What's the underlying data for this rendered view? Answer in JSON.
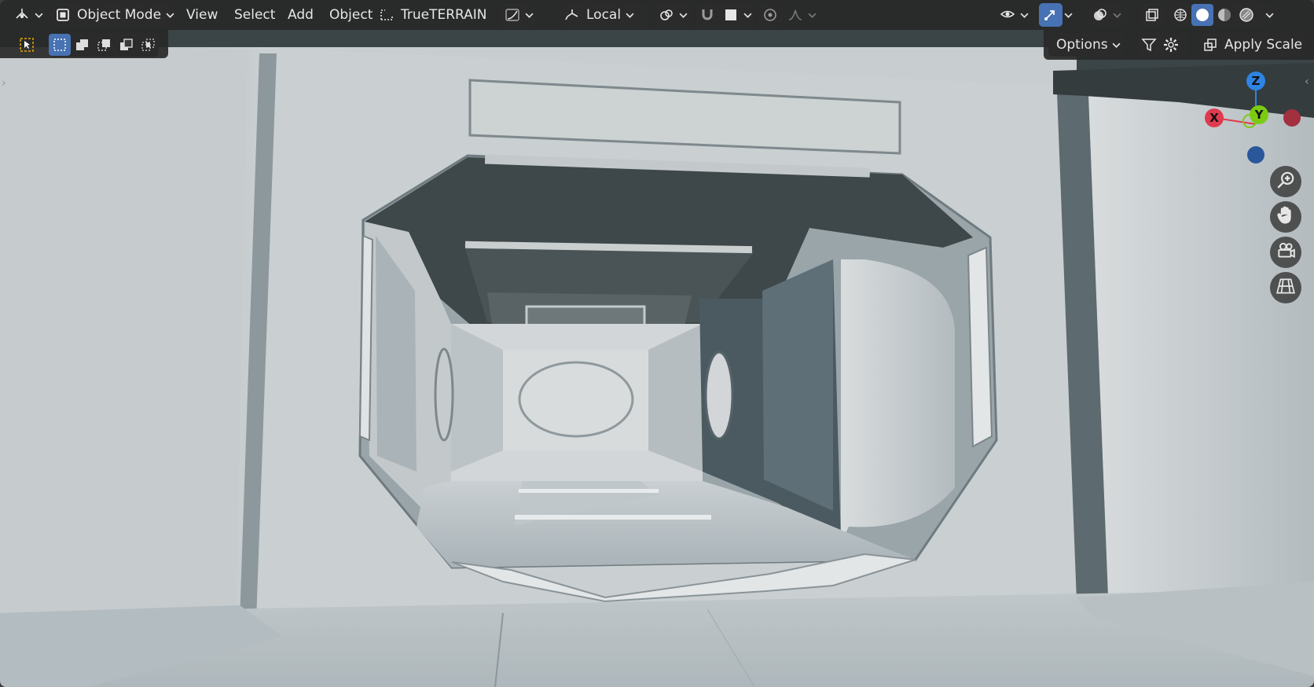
{
  "header": {
    "editor_type_icon": "object-3d-viewport-icon",
    "mode_label": "Object Mode",
    "menus": [
      "View",
      "Select",
      "Add",
      "Object"
    ],
    "addon_label": "TrueTERRAIN",
    "transform_orientation": "Local"
  },
  "toolbar": {
    "select_tools": [
      "cursor-select-icon",
      "box-select-new-icon",
      "box-select-extend-icon",
      "box-select-subtract-icon",
      "box-select-invert-icon",
      "box-select-intersect-icon"
    ]
  },
  "options": {
    "options_label": "Options",
    "apply_scale_label": "Apply Scale"
  },
  "gizmo": {
    "axis_z": "Z",
    "axis_y": "Y",
    "axis_x": "X",
    "colors": {
      "x": "#e03a4e",
      "y": "#7ccb13",
      "z": "#2f83e3",
      "neg_z": "#2a5799",
      "neg_x": "#a3303f"
    }
  },
  "navigation": [
    "zoom-icon",
    "pan-hand-icon",
    "camera-view-icon",
    "perspective-grid-icon"
  ],
  "viewport_shading": [
    "wireframe-shading-icon",
    "solid-shading-icon",
    "material-shading-icon",
    "rendered-shading-icon"
  ],
  "scene_colors": {
    "wall": "#c9ced0",
    "ceiling_dark": "#3b4446",
    "floor": "#b7c0c4",
    "accent_blue": "#4772b3"
  }
}
